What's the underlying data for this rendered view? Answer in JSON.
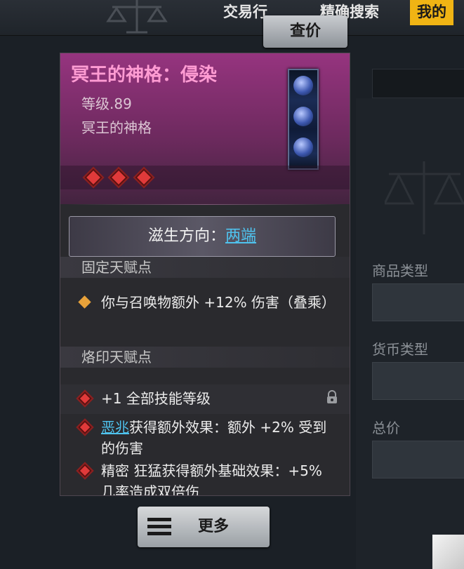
{
  "top_nav": {
    "tabs": [
      {
        "label": "交易行"
      },
      {
        "label": "精确搜索"
      },
      {
        "label": "我的"
      }
    ],
    "active_tab": 2
  },
  "price_check_button": {
    "label": "查价"
  },
  "item": {
    "name": "冥王的神格：侵染",
    "level": "等级.89",
    "base_type": "冥王的神格",
    "rarity_color": "#ff9cd3",
    "rune_count": 3,
    "growth": {
      "prefix": "滋生方向：",
      "value": "两端"
    },
    "fixed_section": {
      "title": "固定天赋点",
      "affixes": [
        {
          "text": "你与召唤物额外 +12% 伤害（叠乘）"
        }
      ]
    },
    "imprint_section": {
      "title": "烙印天赋点",
      "affixes": [
        {
          "text": "+1 全部技能等级",
          "locked": true
        },
        {
          "link": "恶兆",
          "text": "获得额外效果：额外 +2% 受到的伤害"
        },
        {
          "text": "精密 狂猛获得额外基础效果：+5% 几率造成双倍伤"
        }
      ]
    }
  },
  "more_button": {
    "label": "更多"
  },
  "filters": {
    "product_type": {
      "label": "商品类型"
    },
    "currency_type": {
      "label": "货币类型"
    },
    "total_price": {
      "label": "总价"
    }
  },
  "colors": {
    "accent": "#f0b414",
    "link": "#4fc3ee",
    "card_header": "#96347f",
    "rune_red": "#e03a3a"
  }
}
